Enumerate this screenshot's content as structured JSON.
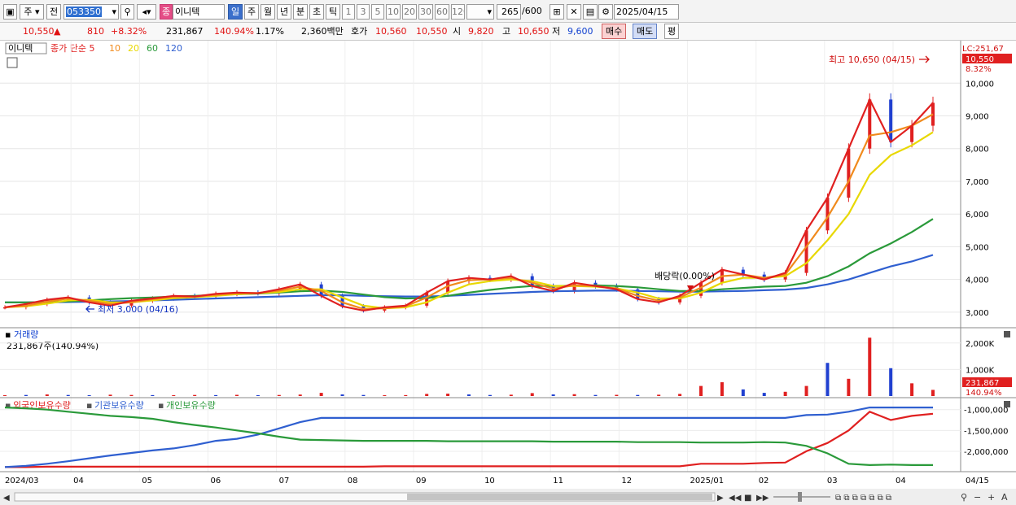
{
  "toolbar": {
    "type_label": "주",
    "prev_label": "전",
    "code": "053350",
    "name_badge": "종",
    "name": "이니텍",
    "periods": [
      "일",
      "주",
      "월",
      "년",
      "분",
      "초",
      "틱"
    ],
    "minutes": [
      "1",
      "3",
      "5",
      "10",
      "20",
      "30",
      "60",
      "120"
    ],
    "count": "265",
    "count_total": "/600",
    "date": "2025/04/15"
  },
  "quote": {
    "price": "10,550",
    "arrow": "▲",
    "change": "810",
    "change_pct": "+8.32%",
    "volume": "231,867",
    "volume_ratio": "140.94%",
    "turnover": "1.17%",
    "amount": "2,360백만",
    "ask_label": "호가",
    "ask1": "10,560",
    "ask2": "10,550",
    "open_label": "시",
    "open": "9,820",
    "high_label": "고",
    "high": "10,650",
    "low_label": "저",
    "low": "9,600",
    "buy_label": "매수",
    "sell_label": "매도",
    "avg_label": "평"
  },
  "chart_data": [
    {
      "type": "candlestick",
      "title": "이니텍",
      "legend": [
        {
          "name": "종가 단순 5",
          "color": "#e02020"
        },
        {
          "name": "10",
          "color": "#f08a1c"
        },
        {
          "name": "20",
          "color": "#e8d800"
        },
        {
          "name": "60",
          "color": "#2a9a3a"
        },
        {
          "name": "120",
          "color": "#2f5fd0"
        }
      ],
      "x_labels": [
        "2024/03",
        "04",
        "05",
        "06",
        "07",
        "08",
        "09",
        "10",
        "11",
        "12",
        "2025/01",
        "02",
        "03",
        "04",
        "04/15"
      ],
      "y_ticks": [
        "10,000",
        "9,000",
        "8,000",
        "7,000",
        "6,000",
        "5,000",
        "4,000",
        "3,000"
      ],
      "ylim": [
        2600,
        11100
      ],
      "lc_label": "LC:251,67",
      "last_price": "10,550",
      "last_pct": "8.32%",
      "annotations": {
        "high": "최고 10,650 (04/15)",
        "low": "최저 3,000 (04/16)",
        "dividend": "배당락(0.00%)"
      },
      "series": [
        {
          "name": "종가 단순 5",
          "color": "#e02020",
          "values": [
            3150,
            3250,
            3380,
            3450,
            3300,
            3200,
            3350,
            3420,
            3500,
            3480,
            3560,
            3600,
            3580,
            3700,
            3850,
            3500,
            3180,
            3050,
            3150,
            3200,
            3600,
            3950,
            4050,
            4000,
            4100,
            3800,
            3650,
            3900,
            3800,
            3700,
            3400,
            3300,
            3500,
            3900,
            4300,
            4150,
            4000,
            4200,
            5500,
            6500,
            8000,
            9500,
            8200,
            8700,
            9400
          ]
        },
        {
          "name": "10",
          "color": "#f08a1c",
          "values": [
            3150,
            3200,
            3320,
            3420,
            3350,
            3250,
            3300,
            3400,
            3470,
            3480,
            3530,
            3580,
            3590,
            3660,
            3780,
            3650,
            3300,
            3100,
            3120,
            3180,
            3450,
            3800,
            3980,
            4000,
            4050,
            3900,
            3720,
            3820,
            3800,
            3720,
            3500,
            3350,
            3450,
            3750,
            4100,
            4150,
            4050,
            4150,
            5000,
            5900,
            7000,
            8400,
            8500,
            8700,
            9050
          ]
        },
        {
          "name": "20",
          "color": "#e8d800",
          "values": [
            3150,
            3180,
            3260,
            3360,
            3380,
            3300,
            3300,
            3360,
            3430,
            3460,
            3500,
            3550,
            3580,
            3620,
            3700,
            3700,
            3450,
            3200,
            3120,
            3150,
            3300,
            3600,
            3850,
            3950,
            4000,
            3950,
            3800,
            3800,
            3780,
            3730,
            3600,
            3420,
            3420,
            3600,
            3900,
            4050,
            4050,
            4100,
            4500,
            5200,
            6000,
            7200,
            7800,
            8100,
            8500
          ]
        },
        {
          "name": "60",
          "color": "#2a9a3a",
          "values": [
            3300,
            3300,
            3310,
            3330,
            3360,
            3400,
            3430,
            3450,
            3480,
            3500,
            3530,
            3550,
            3570,
            3600,
            3640,
            3660,
            3620,
            3540,
            3460,
            3420,
            3430,
            3500,
            3600,
            3680,
            3750,
            3800,
            3800,
            3810,
            3820,
            3800,
            3760,
            3700,
            3650,
            3650,
            3700,
            3740,
            3780,
            3800,
            3900,
            4100,
            4400,
            4800,
            5100,
            5450,
            5850
          ]
        },
        {
          "name": "120",
          "color": "#2f5fd0",
          "values": [
            3300,
            3300,
            3300,
            3310,
            3320,
            3330,
            3340,
            3360,
            3380,
            3400,
            3420,
            3440,
            3460,
            3480,
            3500,
            3520,
            3520,
            3500,
            3490,
            3480,
            3480,
            3500,
            3530,
            3560,
            3590,
            3620,
            3640,
            3650,
            3660,
            3660,
            3650,
            3640,
            3630,
            3630,
            3640,
            3650,
            3670,
            3690,
            3740,
            3850,
            4000,
            4200,
            4400,
            4550,
            4750
          ]
        }
      ]
    },
    {
      "type": "bar",
      "title": "거래량",
      "subtitle": "231,867주(140.94%)",
      "y_ticks": [
        "2,000K",
        "1,000K"
      ],
      "ylim": [
        0,
        2300
      ],
      "last_value": "231,867",
      "last_pct": "140.94%",
      "values": [
        30,
        40,
        60,
        40,
        30,
        50,
        40,
        35,
        30,
        40,
        35,
        45,
        30,
        40,
        55,
        120,
        60,
        40,
        30,
        35,
        80,
        90,
        60,
        40,
        50,
        110,
        60,
        70,
        40,
        45,
        40,
        50,
        80,
        380,
        520,
        250,
        120,
        160,
        380,
        1250,
        650,
        2200,
        1050,
        480,
        232
      ],
      "colors": [
        "r",
        "b",
        "r",
        "b",
        "b",
        "r",
        "r",
        "b",
        "r",
        "r",
        "b",
        "r",
        "b",
        "r",
        "r",
        "r",
        "b",
        "b",
        "r",
        "r",
        "r",
        "r",
        "b",
        "b",
        "r",
        "r",
        "b",
        "r",
        "b",
        "r",
        "b",
        "r",
        "r",
        "r",
        "r",
        "b",
        "b",
        "r",
        "r",
        "b",
        "r",
        "r",
        "b",
        "r",
        "r"
      ]
    },
    {
      "type": "line",
      "legend": [
        {
          "name": "외국인보유수량",
          "color": "#e02020"
        },
        {
          "name": "기관보유수량",
          "color": "#2f5fd0"
        },
        {
          "name": "개인보유수량",
          "color": "#2a9a3a"
        }
      ],
      "y_ticks": [
        "-1,000,000",
        "-1,500,000",
        "-2,000,000"
      ],
      "ylim": [
        -2450000,
        -850000
      ],
      "series": [
        {
          "name": "외국인보유수량",
          "color": "#e02020",
          "values": [
            -2380000,
            -2380000,
            -2370000,
            -2370000,
            -2370000,
            -2370000,
            -2370000,
            -2370000,
            -2370000,
            -2370000,
            -2370000,
            -2370000,
            -2370000,
            -2370000,
            -2370000,
            -2370000,
            -2370000,
            -2370000,
            -2360000,
            -2360000,
            -2360000,
            -2360000,
            -2360000,
            -2360000,
            -2360000,
            -2360000,
            -2360000,
            -2360000,
            -2360000,
            -2360000,
            -2360000,
            -2360000,
            -2360000,
            -2300000,
            -2300000,
            -2300000,
            -2280000,
            -2270000,
            -2000000,
            -1800000,
            -1500000,
            -1050000,
            -1250000,
            -1150000,
            -1100000
          ]
        },
        {
          "name": "기관보유수량",
          "color": "#2f5fd0",
          "values": [
            -2380000,
            -2350000,
            -2300000,
            -2240000,
            -2170000,
            -2100000,
            -2040000,
            -1980000,
            -1930000,
            -1850000,
            -1750000,
            -1700000,
            -1600000,
            -1450000,
            -1300000,
            -1200000,
            -1200000,
            -1200000,
            -1200000,
            -1200000,
            -1200000,
            -1200000,
            -1200000,
            -1200000,
            -1200000,
            -1200000,
            -1200000,
            -1200000,
            -1200000,
            -1200000,
            -1200000,
            -1200000,
            -1200000,
            -1200000,
            -1200000,
            -1200000,
            -1200000,
            -1200000,
            -1130000,
            -1120000,
            -1050000,
            -950000,
            -950000,
            -950000,
            -950000
          ]
        },
        {
          "name": "개인보유수량",
          "color": "#2a9a3a",
          "values": [
            -950000,
            -970000,
            -1000000,
            -1050000,
            -1100000,
            -1150000,
            -1180000,
            -1220000,
            -1300000,
            -1370000,
            -1430000,
            -1500000,
            -1570000,
            -1650000,
            -1720000,
            -1730000,
            -1740000,
            -1750000,
            -1750000,
            -1750000,
            -1750000,
            -1760000,
            -1760000,
            -1760000,
            -1760000,
            -1760000,
            -1770000,
            -1770000,
            -1770000,
            -1770000,
            -1780000,
            -1780000,
            -1780000,
            -1790000,
            -1790000,
            -1790000,
            -1780000,
            -1790000,
            -1870000,
            -2050000,
            -2300000,
            -2330000,
            -2320000,
            -2330000,
            -2330000
          ]
        }
      ]
    }
  ]
}
